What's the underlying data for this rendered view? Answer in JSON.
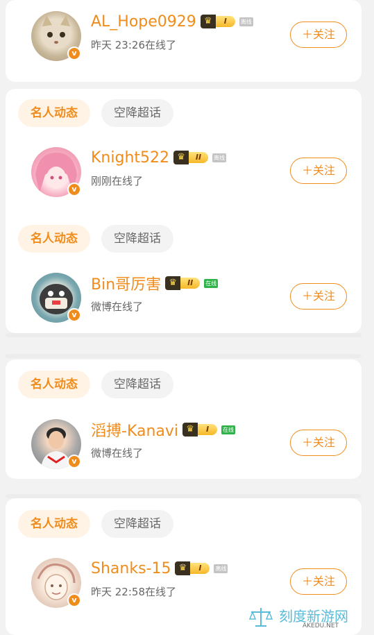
{
  "entries": [
    {
      "name": "AL_Hope0929",
      "level": "I",
      "status": "离线",
      "online": "昨天 23:26在线了",
      "follow": "＋关注"
    },
    {
      "name": "Knight522",
      "level": "II",
      "status": "离线",
      "online": "刚刚在线了",
      "follow": "＋关注"
    },
    {
      "name": "Bin哥厉害",
      "level": "II",
      "status": "在线",
      "online": "微博在线了",
      "follow": "＋关注"
    },
    {
      "name": "滔搏-Kanavi",
      "level": "I",
      "status": "在线",
      "online": "微博在线了",
      "follow": "＋关注"
    },
    {
      "name": "Shanks-15",
      "level": "I",
      "status": "离线",
      "online": "昨天 22:58在线了",
      "follow": "＋关注"
    }
  ],
  "tabs": {
    "active": "名人动态",
    "inactive": "空降超话"
  },
  "badge": {
    "v": "v"
  },
  "watermark": {
    "text": "刻度新游网",
    "sub": "AKEDU.NET"
  },
  "colors": {
    "accent": "#f08c1c",
    "online_green": "#2fb24a",
    "offline_gray": "#c4c4c4",
    "watermark": "#5bbcd9"
  },
  "icons": {
    "level_crown": "crown-icon",
    "verified": "verified-v-icon",
    "watermark_logo": "scales-icon"
  }
}
